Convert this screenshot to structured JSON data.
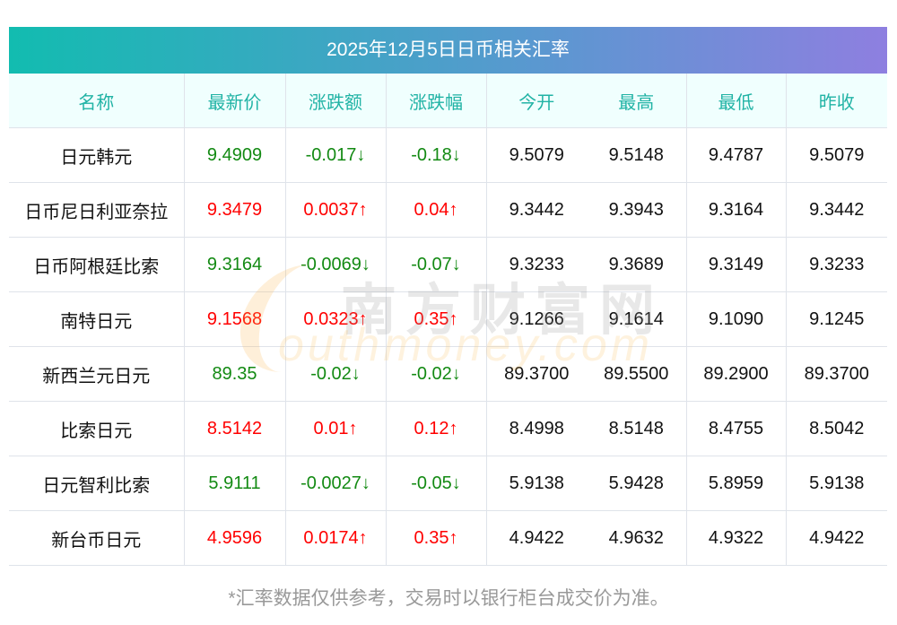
{
  "title": "2025年12月5日日币相关汇率",
  "headers": [
    "名称",
    "最新价",
    "涨跌额",
    "涨跌幅",
    "今开",
    "最高",
    "最低",
    "昨收"
  ],
  "rows": [
    {
      "name": "日元韩元",
      "latest": "9.4909",
      "change": "-0.017↓",
      "pct": "-0.18↓",
      "open": "9.5079",
      "high": "9.5148",
      "low": "9.4787",
      "prev": "9.5079",
      "dir": "dn"
    },
    {
      "name": "日币尼日利亚奈拉",
      "latest": "9.3479",
      "change": "0.0037↑",
      "pct": "0.04↑",
      "open": "9.3442",
      "high": "9.3943",
      "low": "9.3164",
      "prev": "9.3442",
      "dir": "up"
    },
    {
      "name": "日币阿根廷比索",
      "latest": "9.3164",
      "change": "-0.0069↓",
      "pct": "-0.07↓",
      "open": "9.3233",
      "high": "9.3689",
      "low": "9.3149",
      "prev": "9.3233",
      "dir": "dn"
    },
    {
      "name": "南特日元",
      "latest": "9.1568",
      "change": "0.0323↑",
      "pct": "0.35↑",
      "open": "9.1266",
      "high": "9.1614",
      "low": "9.1090",
      "prev": "9.1245",
      "dir": "up"
    },
    {
      "name": "新西兰元日元",
      "latest": "89.35",
      "change": "-0.02↓",
      "pct": "-0.02↓",
      "open": "89.3700",
      "high": "89.5500",
      "low": "89.2900",
      "prev": "89.3700",
      "dir": "dn"
    },
    {
      "name": "比索日元",
      "latest": "8.5142",
      "change": "0.01↑",
      "pct": "0.12↑",
      "open": "8.4998",
      "high": "8.5148",
      "low": "8.4755",
      "prev": "8.5042",
      "dir": "up"
    },
    {
      "name": "日元智利比索",
      "latest": "5.9111",
      "change": "-0.0027↓",
      "pct": "-0.05↓",
      "open": "5.9138",
      "high": "5.9428",
      "low": "5.8959",
      "prev": "5.9138",
      "dir": "dn"
    },
    {
      "name": "新台币日元",
      "latest": "4.9596",
      "change": "0.0174↑",
      "pct": "0.35↑",
      "open": "4.9422",
      "high": "4.9632",
      "low": "4.9322",
      "prev": "4.9422",
      "dir": "up"
    }
  ],
  "footer": "*汇率数据仅供参考，交易时以银行柜台成交价为准。",
  "watermark": {
    "cn": "南方财富网",
    "en": "outhmoney.com"
  },
  "colors": {
    "up": "#ff0000",
    "down": "#138a13",
    "header": "#21b3a5"
  }
}
